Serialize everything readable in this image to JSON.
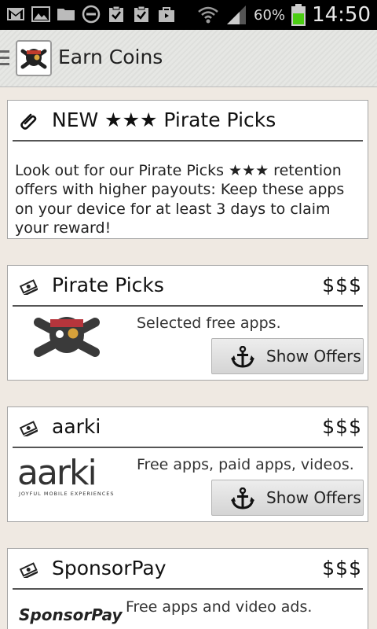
{
  "status_bar": {
    "battery_percent": "60%",
    "time": "14:50",
    "icons": [
      "gmail-icon",
      "gallery-icon",
      "folder-icon",
      "block-icon",
      "clipboard-check-icon",
      "clipboard-check-icon",
      "shop-bag-icon",
      "wifi-icon",
      "signal-icon",
      "battery-icon"
    ]
  },
  "header": {
    "title": "Earn Coins"
  },
  "news": {
    "title": "NEW ★★★ Pirate Picks",
    "body": "Look out for our Pirate Picks ★★★ retention offers with higher payouts: Keep these apps on your device for at least 3 days to claim your reward!"
  },
  "offers": [
    {
      "name": "Pirate Picks",
      "price": "$$$",
      "description": "Selected free apps.",
      "button": "Show Offers"
    },
    {
      "name": "aarki",
      "price": "$$$",
      "description": "Free apps, paid apps, videos.",
      "button": "Show Offers",
      "logo_text": "aarki",
      "logo_tagline": "JOYFUL MOBILE EXPERIENCES"
    },
    {
      "name": "SponsorPay",
      "price": "$$$",
      "description": "Free apps and video ads.",
      "logo_text": "SponsorPay"
    }
  ],
  "colors": {
    "battery_green": "#4ccd14",
    "status_bg": "#000000",
    "card_border": "#a5a5a5"
  }
}
